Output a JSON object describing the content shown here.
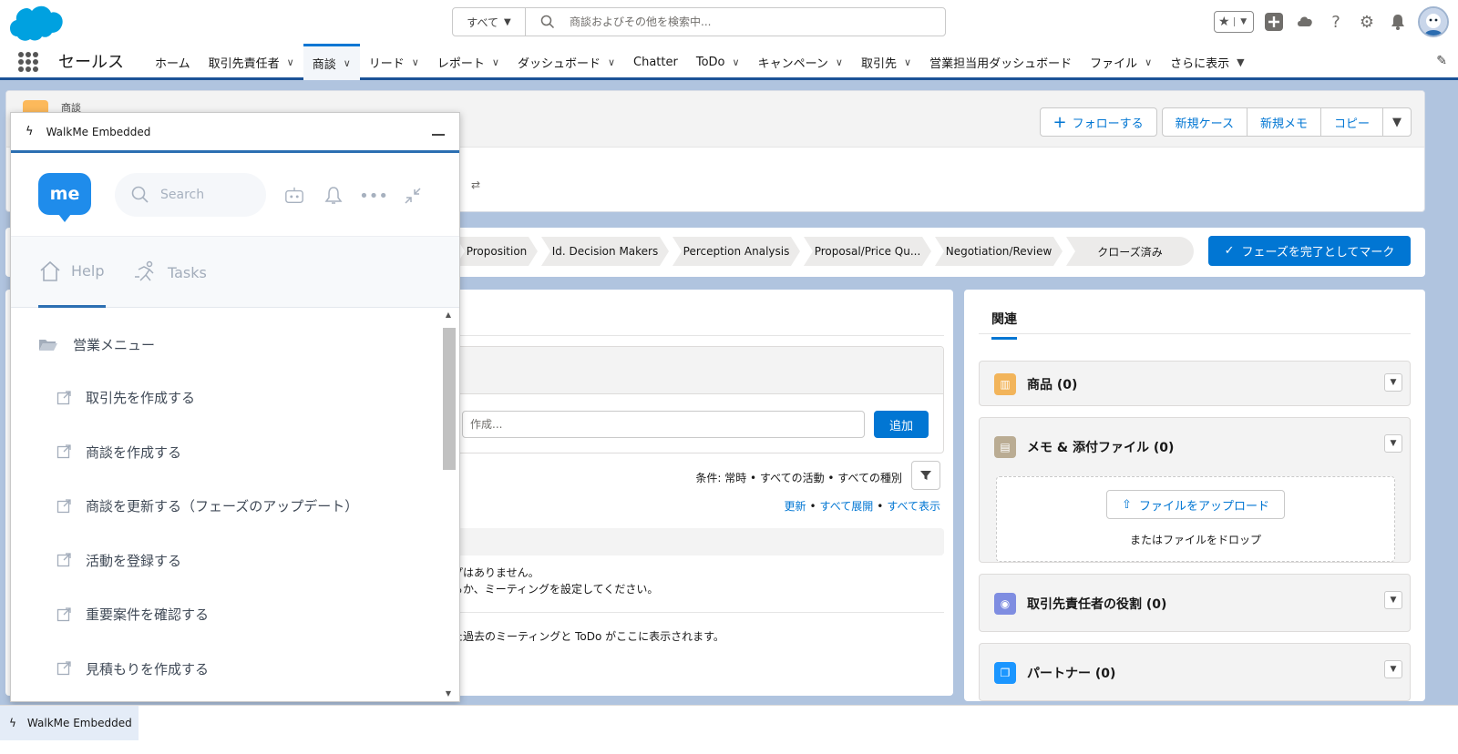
{
  "colors": {
    "brand": "#00a1e0",
    "accent": "#0176d3",
    "nav_border": "#1b5297",
    "walkme_blue": "#1f8ceb"
  },
  "global_header": {
    "search_scope": "すべて",
    "search_placeholder": "商談およびその他を検索中..."
  },
  "nav": {
    "app_name": "セールス",
    "tabs": [
      {
        "label": "ホーム",
        "chevron": false,
        "active": false
      },
      {
        "label": "取引先責任者",
        "chevron": true,
        "active": false
      },
      {
        "label": "商談",
        "chevron": true,
        "active": true
      },
      {
        "label": "リード",
        "chevron": true,
        "active": false
      },
      {
        "label": "レポート",
        "chevron": true,
        "active": false
      },
      {
        "label": "ダッシュボード",
        "chevron": true,
        "active": false
      },
      {
        "label": "Chatter",
        "chevron": false,
        "active": false
      },
      {
        "label": "ToDo",
        "chevron": true,
        "active": false
      },
      {
        "label": "キャンペーン",
        "chevron": true,
        "active": false
      },
      {
        "label": "取引先",
        "chevron": true,
        "active": false
      },
      {
        "label": "営業担当用ダッシュボード",
        "chevron": false,
        "active": false
      },
      {
        "label": "ファイル",
        "chevron": true,
        "active": false
      },
      {
        "label": "さらに表示",
        "chevron": true,
        "active": false
      }
    ]
  },
  "record_header": {
    "object_label": "商談",
    "buttons": {
      "follow": "フォローする",
      "new_case": "新規ケース",
      "new_note": "新規メモ",
      "copy": "コピー"
    }
  },
  "path": {
    "steps": [
      "Proposition",
      "Id. Decision Makers",
      "Perception Analysis",
      "Proposal/Price Qu...",
      "Negotiation/Review",
      "クローズ済み"
    ],
    "complete_button": "フェーズを完了としてマーク"
  },
  "activity": {
    "input_placeholder": "作成...",
    "add_button": "追加",
    "filter_text": "条件: 常時 • すべての活動 • すべての種別",
    "link_refresh": "更新",
    "link_expand": "すべて展開",
    "link_view_all": "すべて表示",
    "empty_next_line1": "プはありません。",
    "empty_next_line2": "るか、ミーティングを設定してください。",
    "empty_past": "た過去のミーティングと ToDo がここに表示されます。"
  },
  "related": {
    "tab": "関連",
    "items": [
      {
        "title": "商品 (0)",
        "icon": "product-icon",
        "color": "#f2b45a"
      },
      {
        "title": "メモ & 添付ファイル (0)",
        "icon": "file-icon",
        "color": "#baac93"
      },
      {
        "title": "取引先責任者の役割 (0)",
        "icon": "contact-role-icon",
        "color": "#7f8de1"
      },
      {
        "title": "パートナー (0)",
        "icon": "partner-icon",
        "color": "#1b96ff"
      }
    ],
    "upload_button": "ファイルをアップロード",
    "drop_text": "またはファイルをドロップ"
  },
  "walkme": {
    "title": "WalkMe Embedded",
    "logo_text": "me",
    "search_placeholder": "Search",
    "tab_help": "Help",
    "tab_tasks": "Tasks",
    "folder": "営業メニュー",
    "items": [
      "取引先を作成する",
      "商談を作成する",
      "商談を更新する（フェーズのアップデート）",
      "活動を登録する",
      "重要案件を確認する",
      "見積もりを作成する"
    ]
  },
  "utility_bar": {
    "label": "WalkMe Embedded"
  }
}
